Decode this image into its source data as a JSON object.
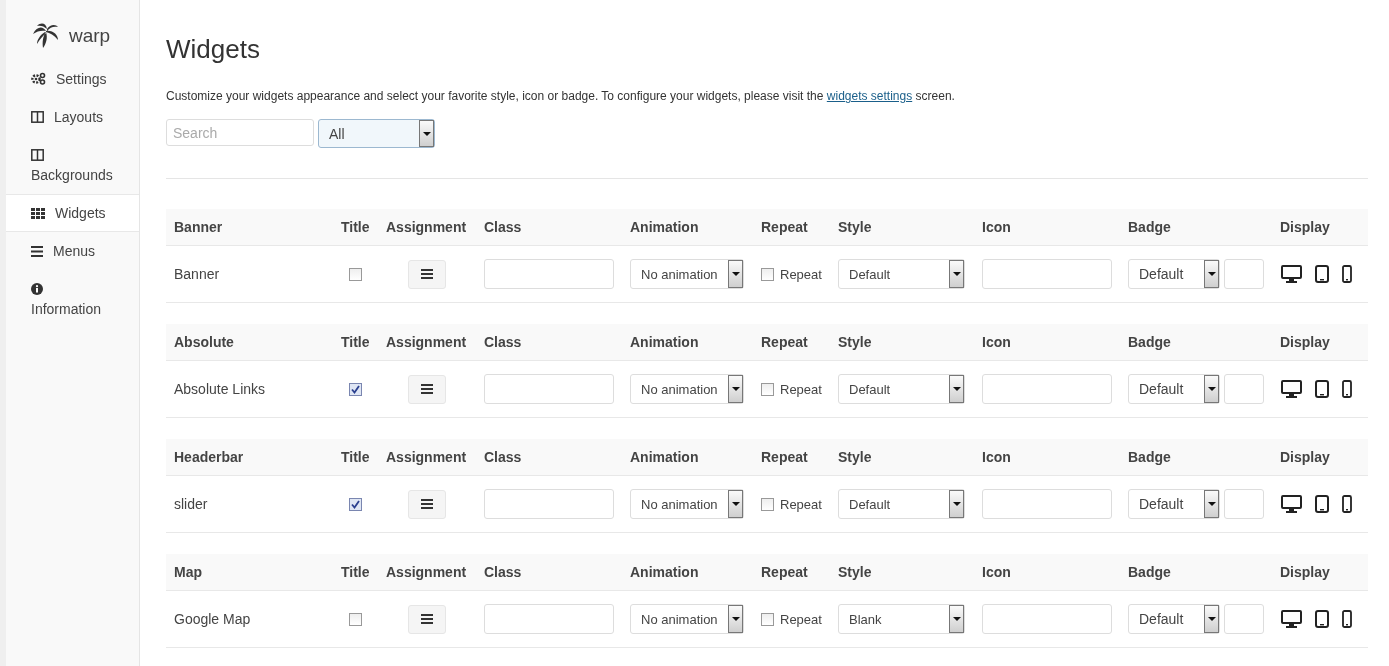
{
  "logo": {
    "text": "warp"
  },
  "sidebar": {
    "items": [
      {
        "label": "Settings",
        "selected": false
      },
      {
        "label": "Layouts",
        "selected": false
      },
      {
        "label": "Backgrounds",
        "selected": false
      },
      {
        "label": "Widgets",
        "selected": true
      },
      {
        "label": "Menus",
        "selected": false
      },
      {
        "label": "Information",
        "selected": false
      }
    ]
  },
  "page": {
    "title": "Widgets",
    "description_before": "Customize your widgets appearance and select your favorite style, icon or badge. To configure your widgets, please visit the",
    "description_link": "widgets settings",
    "description_after": "screen.",
    "search": {
      "placeholder": "Search"
    },
    "filter": {
      "value": "All"
    }
  },
  "groups": [
    {
      "name": "Banner",
      "columns": [
        "Title",
        "Assignment",
        "Class",
        "Animation",
        "Repeat",
        "Style",
        "Icon",
        "Badge",
        "Display"
      ],
      "widget": {
        "name": "Banner",
        "title_checked": false,
        "animation": "No animation",
        "repeat_checked": false,
        "repeat_label": "Repeat",
        "style": "Default",
        "badge": "Default"
      }
    },
    {
      "name": "Absolute",
      "columns": [
        "Title",
        "Assignment",
        "Class",
        "Animation",
        "Repeat",
        "Style",
        "Icon",
        "Badge",
        "Display"
      ],
      "widget": {
        "name": "Absolute Links",
        "title_checked": true,
        "animation": "No animation",
        "repeat_checked": false,
        "repeat_label": "Repeat",
        "style": "Default",
        "badge": "Default"
      }
    },
    {
      "name": "Headerbar",
      "columns": [
        "Title",
        "Assignment",
        "Class",
        "Animation",
        "Repeat",
        "Style",
        "Icon",
        "Badge",
        "Display"
      ],
      "widget": {
        "name": "slider",
        "title_checked": true,
        "animation": "No animation",
        "repeat_checked": false,
        "repeat_label": "Repeat",
        "style": "Default",
        "badge": "Default"
      }
    },
    {
      "name": "Map",
      "columns": [
        "Title",
        "Assignment",
        "Class",
        "Animation",
        "Repeat",
        "Style",
        "Icon",
        "Badge",
        "Display"
      ],
      "widget": {
        "name": "Google Map",
        "title_checked": false,
        "animation": "No animation",
        "repeat_checked": false,
        "repeat_label": "Repeat",
        "style": "Blank",
        "badge": "Default"
      }
    }
  ]
}
